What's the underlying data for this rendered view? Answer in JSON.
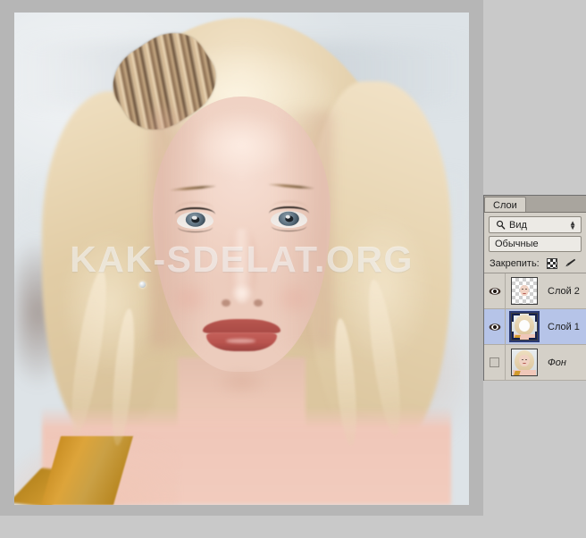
{
  "app": {
    "watermark": "KAK-SDELAT.ORG"
  },
  "panel": {
    "tab_label": "Слои",
    "filter": {
      "icon": "search-icon",
      "value": "Вид",
      "spinner_up": "▲",
      "spinner_down": "▼"
    },
    "blend_mode": "Обычные",
    "lock": {
      "label": "Закрепить:",
      "icons": [
        "transparency-checker-icon",
        "brush-icon"
      ]
    },
    "layers": [
      {
        "name": "Слой 2",
        "visible": true,
        "selected": false,
        "italic": false,
        "thumb": "transparent-face"
      },
      {
        "name": "Слой 1",
        "visible": true,
        "selected": true,
        "italic": false,
        "thumb": "portrait-blank-face"
      },
      {
        "name": "Фон",
        "visible": false,
        "selected": false,
        "italic": true,
        "thumb": "portrait-full"
      }
    ]
  },
  "colors": {
    "panel_bg": "#d4d0c8",
    "selection_blue": "#b6c4e8",
    "canvas_gray": "#b6b6b6",
    "app_bg": "#c9c9c9",
    "strap_gold": "#d19a2c"
  }
}
